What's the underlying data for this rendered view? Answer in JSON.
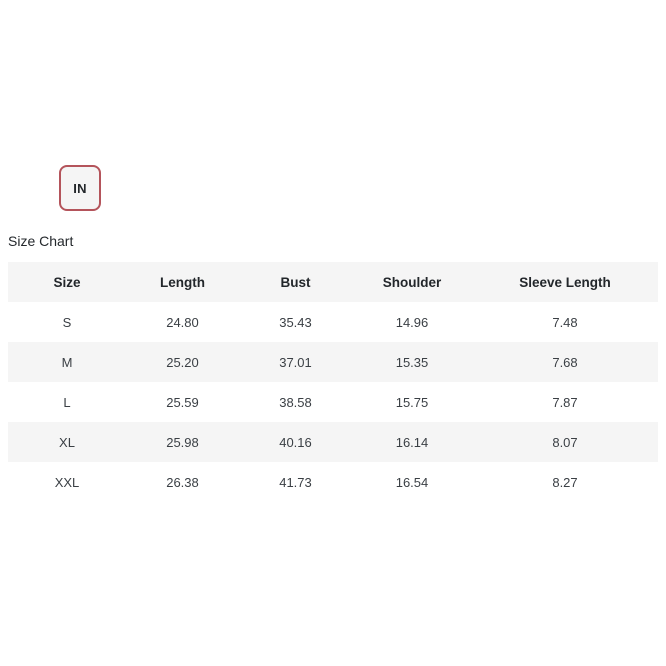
{
  "unit_toggle": {
    "label": "IN",
    "selected": true,
    "border_color": "#b4545b",
    "background_color": "#f5f5f5"
  },
  "size_chart": {
    "caption": "Size Chart",
    "columns": [
      "Size",
      "Length",
      "Bust",
      "Shoulder",
      "Sleeve Length"
    ],
    "rows": [
      {
        "size": "S",
        "length": "24.80",
        "bust": "35.43",
        "shoulder": "14.96",
        "sleeve_length": "7.48"
      },
      {
        "size": "M",
        "length": "25.20",
        "bust": "37.01",
        "shoulder": "15.35",
        "sleeve_length": "7.68"
      },
      {
        "size": "L",
        "length": "25.59",
        "bust": "38.58",
        "shoulder": "15.75",
        "sleeve_length": "7.87"
      },
      {
        "size": "XL",
        "length": "25.98",
        "bust": "40.16",
        "shoulder": "16.14",
        "sleeve_length": "8.07"
      },
      {
        "size": "XXL",
        "length": "26.38",
        "bust": "41.73",
        "shoulder": "16.54",
        "sleeve_length": "8.27"
      }
    ],
    "header_background": "#f5f5f5",
    "stripe_background": "#f5f5f5",
    "base_background": "#ffffff"
  }
}
